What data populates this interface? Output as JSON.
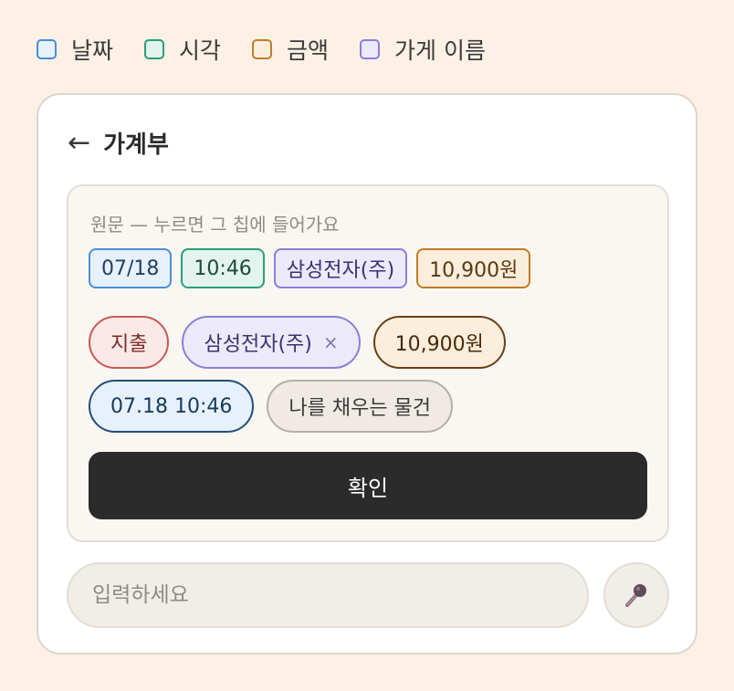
{
  "legend": [
    {
      "label": "날짜"
    },
    {
      "label": "시각"
    },
    {
      "label": "금액"
    },
    {
      "label": "가게 이름"
    }
  ],
  "header": {
    "back_icon": "←",
    "title": "가계부"
  },
  "panel": {
    "hint": "원문 — 누르면 그 칩에 들어가요",
    "original_chips": [
      "07/18",
      "10:46",
      "삼성전자(주)",
      "10,900원"
    ],
    "type_chip": "지출",
    "store_chip": "삼성전자(주)",
    "remove_icon": "×",
    "amount_chip": "10,900원",
    "datetime_chip": "07.18 10:46",
    "category_chip": "나를 채우는 물건",
    "confirm_label": "확인"
  },
  "composer": {
    "placeholder": "입력하세요"
  },
  "colors": {
    "background": "#fdf1e5",
    "date": "#4a8fd6",
    "time": "#2c9d7a",
    "amount": "#c47c25",
    "store": "#8a7fd9",
    "expense": "#c85b56",
    "button": "#2b2b2b"
  }
}
